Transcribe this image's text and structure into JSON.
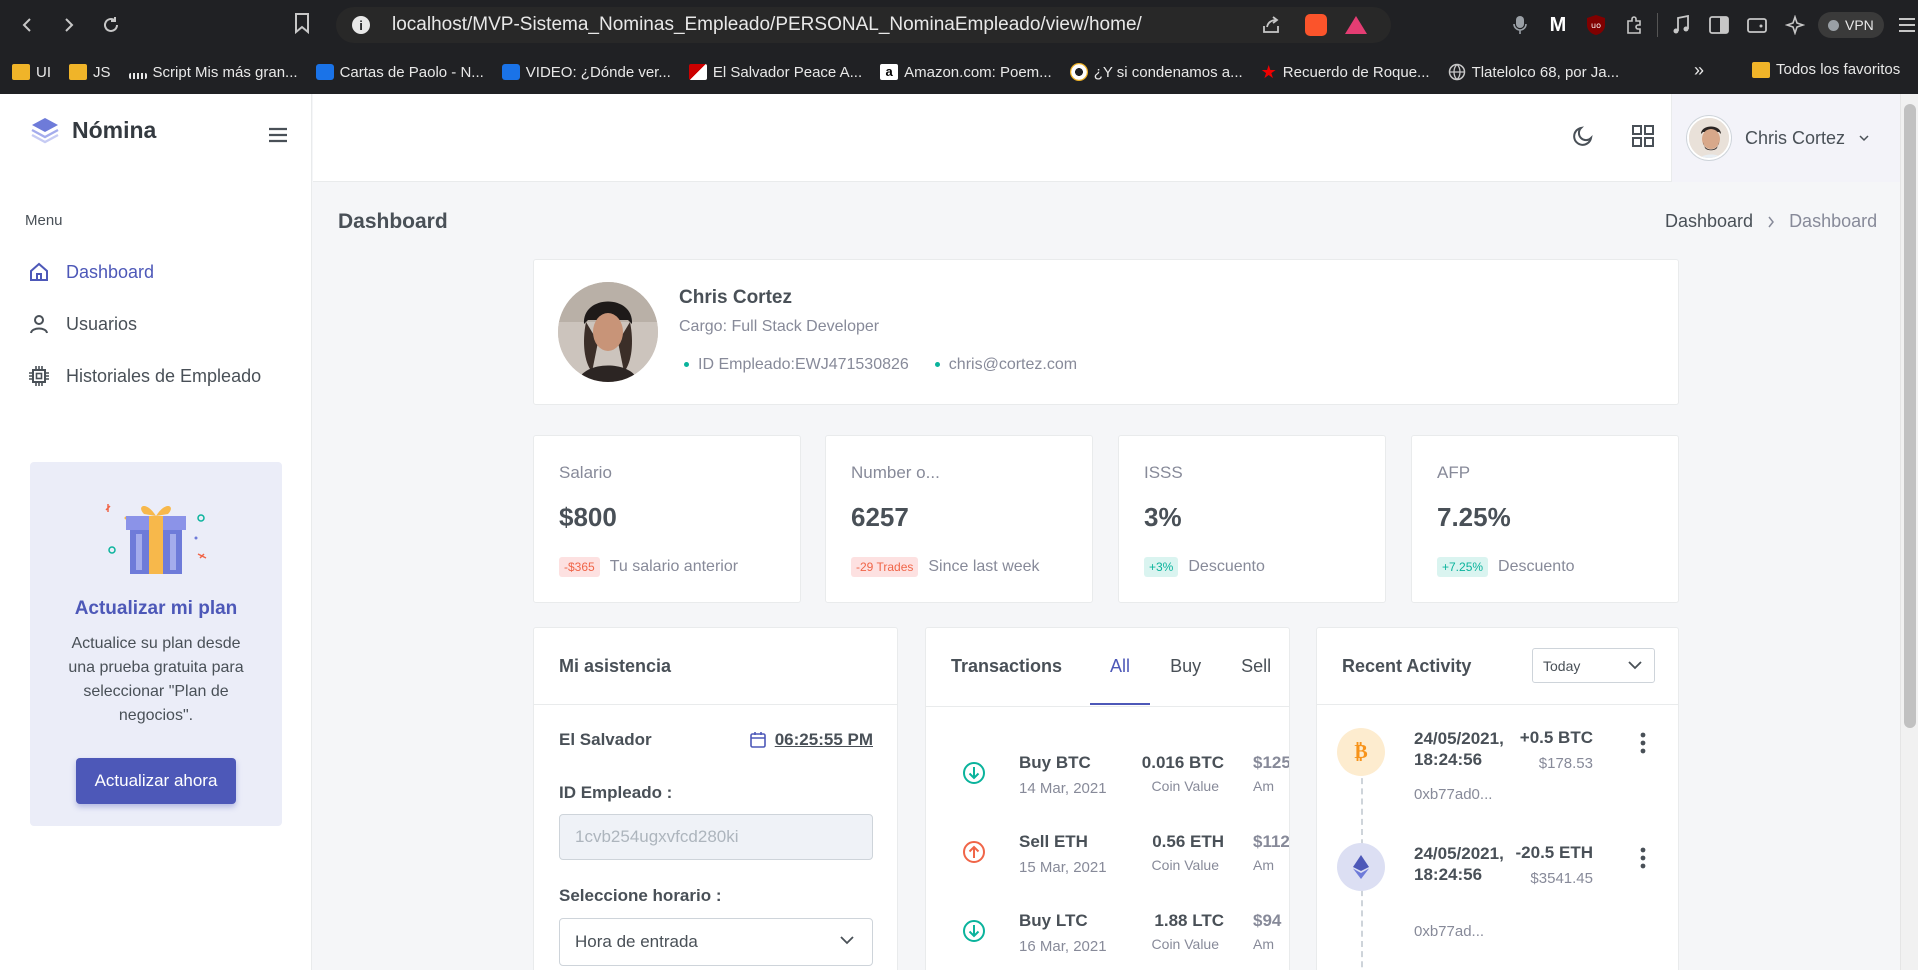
{
  "browser": {
    "url": "localhost/MVP-Sistema_Nominas_Empleado/PERSONAL_NominaEmpleado/view/home/",
    "vpn_label": "VPN",
    "bookmarks": [
      {
        "label": "UI",
        "icon": "folder-icon"
      },
      {
        "label": "JS",
        "icon": "folder-icon"
      },
      {
        "label": "Script Mis más gran...",
        "icon": "script-icon"
      },
      {
        "label": "Cartas de Paolo - N...",
        "icon": "blog-icon"
      },
      {
        "label": "VIDEO: ¿Dónde ver...",
        "icon": "blog-icon"
      },
      {
        "label": "El Salvador Peace A...",
        "icon": "flag-icon"
      },
      {
        "label": "Amazon.com: Poem...",
        "icon": "amazon-icon"
      },
      {
        "label": "¿Y si condenamos a...",
        "icon": "circle-icon"
      },
      {
        "label": "Recuerdo de Roque...",
        "icon": "star-icon"
      },
      {
        "label": "Tlatelolco 68, por Ja...",
        "icon": "globe-icon"
      }
    ],
    "bookmarks_more": "»",
    "all_bookmarks": "Todos los favoritos"
  },
  "sidebar": {
    "brand": "Nómina",
    "menu_title": "Menu",
    "items": [
      {
        "label": "Dashboard",
        "icon": "home-icon",
        "active": true
      },
      {
        "label": "Usuarios",
        "icon": "user-icon",
        "active": false
      },
      {
        "label": "Historiales de Empleado",
        "icon": "chip-icon",
        "active": false
      }
    ],
    "upgrade": {
      "title": "Actualizar mi plan",
      "text": "Actualice su plan desde una prueba gratuita para seleccionar \"Plan de negocios\".",
      "button": "Actualizar ahora"
    }
  },
  "topbar": {
    "user_name": "Chris Cortez"
  },
  "page": {
    "title": "Dashboard",
    "breadcrumb": [
      "Dashboard",
      "Dashboard"
    ]
  },
  "profile": {
    "name": "Chris Cortez",
    "role": "Cargo: Full Stack Developer",
    "employee_id": "ID Empleado:EWJ471530826",
    "email": "chris@cortez.com"
  },
  "stats": [
    {
      "label": "Salario",
      "value": "$800",
      "badge": "-$365",
      "badge_type": "red",
      "sub": "Tu salario anterior"
    },
    {
      "label": "Number o...",
      "value": "6257",
      "badge": "-29 Trades",
      "badge_type": "red",
      "sub": "Since last week"
    },
    {
      "label": "ISSS",
      "value": "3%",
      "badge": "+3%",
      "badge_type": "green",
      "sub": "Descuento"
    },
    {
      "label": "AFP",
      "value": "7.25%",
      "badge": "+7.25%",
      "badge_type": "green",
      "sub": "Descuento"
    }
  ],
  "attendance": {
    "title": "Mi asistencia",
    "country": "El Salvador",
    "time": "06:25:55 PM",
    "id_label": "ID Empleado :",
    "id_value": "1cvb254ugxvfcd280ki",
    "schedule_label": "Seleccione horario :",
    "schedule_value": "Hora de entrada"
  },
  "transactions": {
    "title": "Transactions",
    "tabs": [
      "All",
      "Buy",
      "Sell"
    ],
    "active_tab": 0,
    "rows": [
      {
        "name": "Buy BTC",
        "date": "14 Mar, 2021",
        "coin": "0.016 BTC",
        "coin_label": "Coin Value",
        "amount": "$125",
        "amount_label": "Am",
        "dir": "down"
      },
      {
        "name": "Sell ETH",
        "date": "15 Mar, 2021",
        "coin": "0.56 ETH",
        "coin_label": "Coin Value",
        "amount": "$112",
        "amount_label": "Am",
        "dir": "up"
      },
      {
        "name": "Buy LTC",
        "date": "16 Mar, 2021",
        "coin": "1.88 LTC",
        "coin_label": "Coin Value",
        "amount": "$94",
        "amount_label": "Am",
        "dir": "down"
      }
    ]
  },
  "activity": {
    "title": "Recent Activity",
    "filter": "Today",
    "items": [
      {
        "when": "24/05/2021, 18:24:56",
        "hash": "0xb77ad0...",
        "qty": "+0.5 BTC",
        "usd": "$178.53",
        "coin": "bitcoin-icon",
        "color": "#f7931a",
        "bg": "#fdeccf"
      },
      {
        "when": "24/05/2021, 18:24:56",
        "hash": "0xb77ad...",
        "qty": "-20.5 ETH",
        "usd": "$3541.45",
        "coin": "ethereum-icon",
        "color": "#4d58b8",
        "bg": "#dcdff3"
      }
    ]
  }
}
